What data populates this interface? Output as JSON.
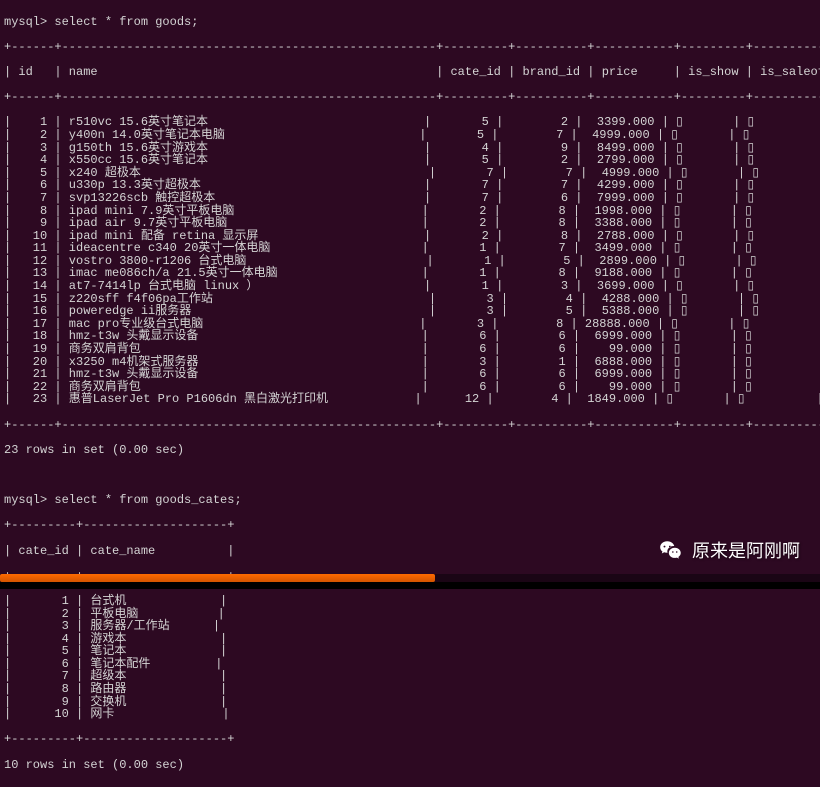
{
  "query1": "mysql> select * from goods;",
  "table1": {
    "headers": [
      "id",
      "name",
      "cate_id",
      "brand_id",
      "price",
      "is_show",
      "is_saleoff"
    ],
    "border_top": "+------+-------------------------------------------+---------+----------+-----------+---------+------------+",
    "header_row": "| id   | name                                      | cate_id | brand_id | price     | is_show | is_saleoff |",
    "rows": [
      {
        "id": "1",
        "name": "r510vc 15.6英寸笔记本",
        "cate_id": "5",
        "brand_id": "2",
        "price": "3399.000"
      },
      {
        "id": "2",
        "name": "y400n 14.0英寸笔记本电脑",
        "cate_id": "5",
        "brand_id": "7",
        "price": "4999.000"
      },
      {
        "id": "3",
        "name": "g150th 15.6英寸游戏本",
        "cate_id": "4",
        "brand_id": "9",
        "price": "8499.000"
      },
      {
        "id": "4",
        "name": "x550cc 15.6英寸笔记本",
        "cate_id": "5",
        "brand_id": "2",
        "price": "2799.000"
      },
      {
        "id": "5",
        "name": "x240 超极本",
        "cate_id": "7",
        "brand_id": "7",
        "price": "4999.000"
      },
      {
        "id": "6",
        "name": "u330p 13.3英寸超极本",
        "cate_id": "7",
        "brand_id": "7",
        "price": "4299.000"
      },
      {
        "id": "7",
        "name": "svp13226scb 触控超极本",
        "cate_id": "7",
        "brand_id": "6",
        "price": "7999.000"
      },
      {
        "id": "8",
        "name": "ipad mini 7.9英寸平板电脑",
        "cate_id": "2",
        "brand_id": "8",
        "price": "1998.000"
      },
      {
        "id": "9",
        "name": "ipad air 9.7英寸平板电脑",
        "cate_id": "2",
        "brand_id": "8",
        "price": "3388.000"
      },
      {
        "id": "10",
        "name": "ipad mini 配备 retina 显示屏",
        "cate_id": "2",
        "brand_id": "8",
        "price": "2788.000"
      },
      {
        "id": "11",
        "name": "ideacentre c340 20英寸一体电脑",
        "cate_id": "1",
        "brand_id": "7",
        "price": "3499.000"
      },
      {
        "id": "12",
        "name": "vostro 3800-r1206 台式电脑",
        "cate_id": "1",
        "brand_id": "5",
        "price": "2899.000"
      },
      {
        "id": "13",
        "name": "imac me086ch/a 21.5英寸一体电脑",
        "cate_id": "1",
        "brand_id": "8",
        "price": "9188.000"
      },
      {
        "id": "14",
        "name": "at7-7414lp 台式电脑 linux ）",
        "cate_id": "1",
        "brand_id": "3",
        "price": "3699.000"
      },
      {
        "id": "15",
        "name": "z220sff f4f06pa工作站",
        "cate_id": "3",
        "brand_id": "4",
        "price": "4288.000"
      },
      {
        "id": "16",
        "name": "poweredge ii服务器",
        "cate_id": "3",
        "brand_id": "5",
        "price": "5388.000"
      },
      {
        "id": "17",
        "name": "mac pro专业级台式电脑",
        "cate_id": "3",
        "brand_id": "8",
        "price": "28888.000"
      },
      {
        "id": "18",
        "name": "hmz-t3w 头戴显示设备",
        "cate_id": "6",
        "brand_id": "6",
        "price": "6999.000"
      },
      {
        "id": "19",
        "name": "商务双肩背包",
        "cate_id": "6",
        "brand_id": "6",
        "price": "99.000"
      },
      {
        "id": "20",
        "name": "x3250 m4机架式服务器",
        "cate_id": "3",
        "brand_id": "1",
        "price": "6888.000"
      },
      {
        "id": "21",
        "name": "hmz-t3w 头戴显示设备",
        "cate_id": "6",
        "brand_id": "6",
        "price": "6999.000"
      },
      {
        "id": "22",
        "name": "商务双肩背包",
        "cate_id": "6",
        "brand_id": "6",
        "price": "99.000"
      },
      {
        "id": "23",
        "name": "惠普LaserJet Pro P1606dn 黑白激光打印机",
        "cate_id": "12",
        "brand_id": "4",
        "price": "1849.000"
      }
    ]
  },
  "result1": "23 rows in set (0.00 sec)",
  "query2": "mysql> select * from goods_cates;",
  "table2": {
    "headers": [
      "cate_id",
      "cate_name"
    ],
    "border": "+---------+-----------------+",
    "header_row": "| cate_id | cate_name       |",
    "rows": [
      {
        "cate_id": "1",
        "cate_name": "台式机"
      },
      {
        "cate_id": "2",
        "cate_name": "平板电脑"
      },
      {
        "cate_id": "3",
        "cate_name": "服务器/工作站"
      },
      {
        "cate_id": "4",
        "cate_name": "游戏本"
      },
      {
        "cate_id": "5",
        "cate_name": "笔记本"
      },
      {
        "cate_id": "6",
        "cate_name": "笔记本配件"
      },
      {
        "cate_id": "7",
        "cate_name": "超级本"
      },
      {
        "cate_id": "8",
        "cate_name": "路由器"
      },
      {
        "cate_id": "9",
        "cate_name": "交换机"
      },
      {
        "cate_id": "10",
        "cate_name": "网卡"
      }
    ]
  },
  "result2": "10 rows in set (0.00 sec)",
  "watermark_text": "原来是阿刚啊"
}
